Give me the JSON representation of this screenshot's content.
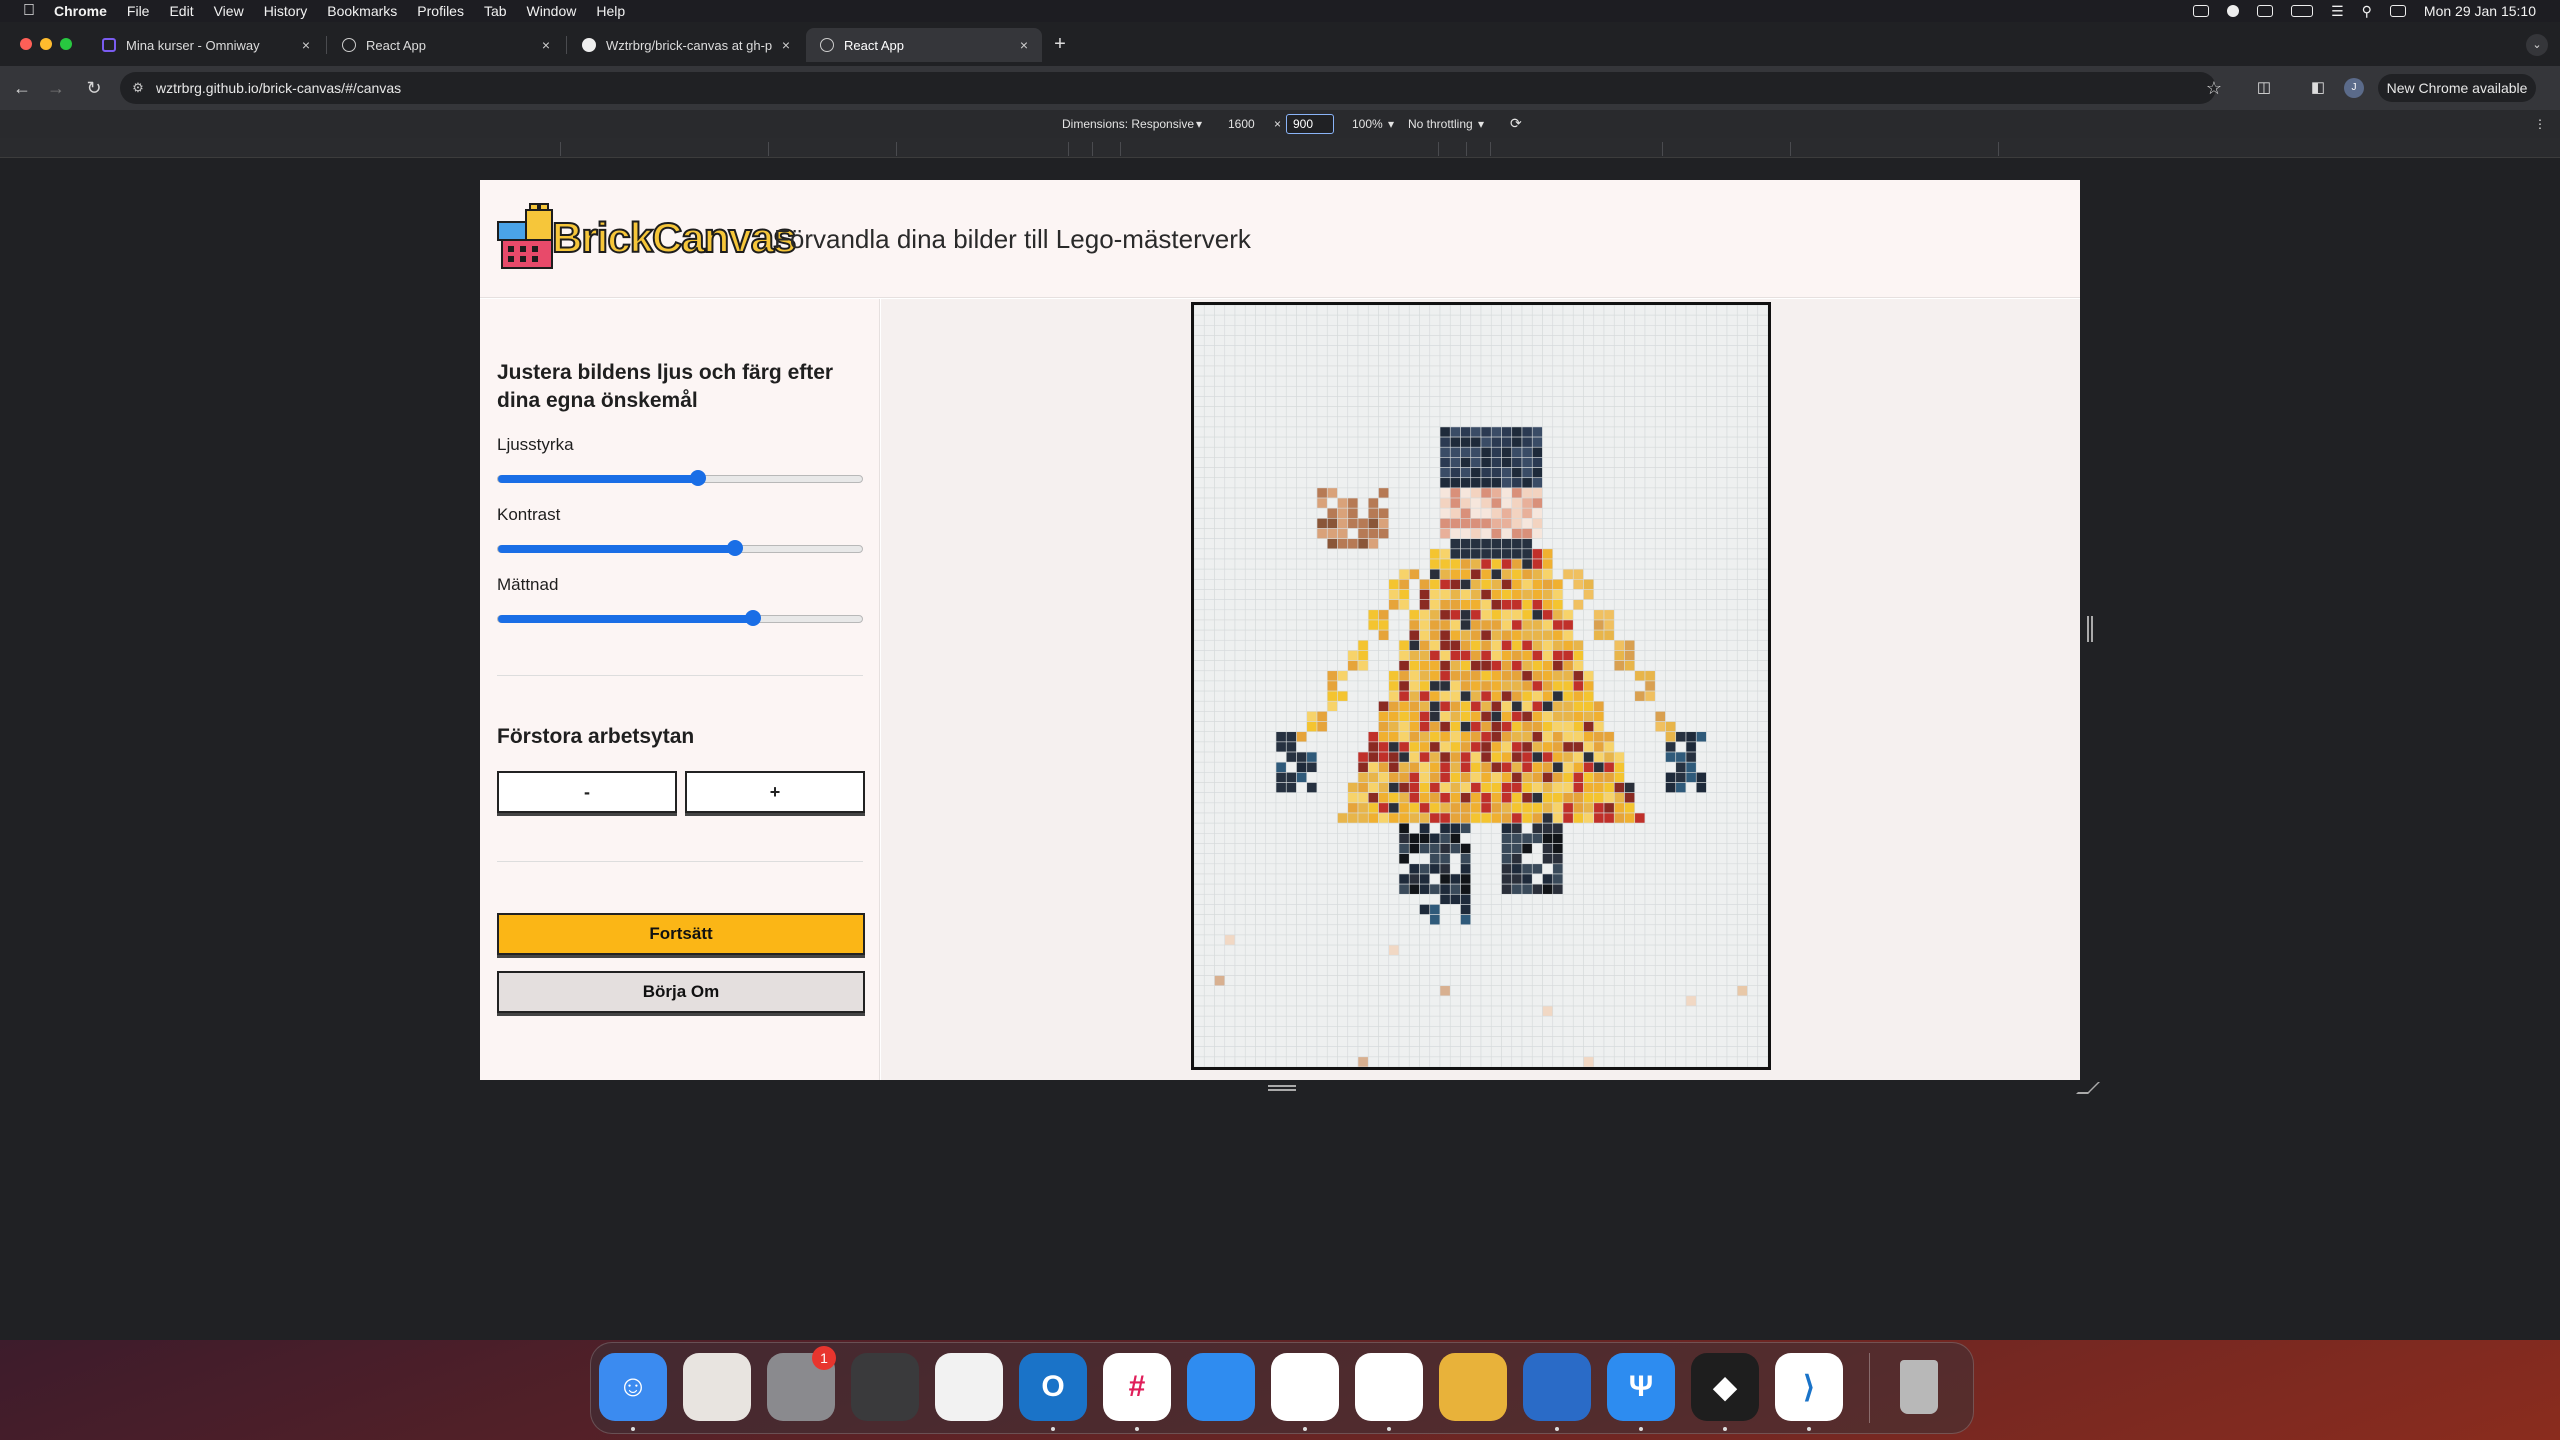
{
  "menubar": {
    "app": "Chrome",
    "items": [
      "File",
      "Edit",
      "View",
      "History",
      "Bookmarks",
      "Profiles",
      "Tab",
      "Window",
      "Help"
    ],
    "clock": "Mon 29 Jan  15:10"
  },
  "tabs": [
    {
      "title": "Mina kurser - Omniway",
      "icon": "omniway-icon"
    },
    {
      "title": "React App",
      "icon": "react-icon"
    },
    {
      "title": "Wztrbrg/brick-canvas at gh-p",
      "icon": "github-icon"
    },
    {
      "title": "React App",
      "icon": "react-icon"
    }
  ],
  "toolbar": {
    "url": "wztrbrg.github.io/brick-canvas/#/canvas",
    "update_label": "New Chrome available",
    "avatar_letter": "J"
  },
  "devtools": {
    "dimensions": "Dimensions: Responsive",
    "width": "1600",
    "height": "900",
    "zoom": "100%",
    "throttling": "No throttling"
  },
  "app": {
    "logo": "BrickCanvas",
    "tagline": "Förvandla dina bilder till Lego-mästerverk",
    "adjust_heading": "Justera bildens ljus och färg efter dina egna önskemål",
    "sliders": [
      {
        "label": "Ljusstyrka",
        "value": 0.55
      },
      {
        "label": "Kontrast",
        "value": 0.65
      },
      {
        "label": "Mättnad",
        "value": 0.7
      }
    ],
    "zoom_heading": "Förstora arbetsytan",
    "zoom_out": "-",
    "zoom_in": "+",
    "continue_label": "Fortsätt",
    "restart_label": "Börja Om"
  },
  "colors": {
    "accent": "#1a6ee6",
    "continue_bg": "#fbb616",
    "restart_bg": "#e4dfde",
    "logo_yellow": "#f6c63a"
  },
  "dock": [
    {
      "name": "finder",
      "color": "#3b8bf0"
    },
    {
      "name": "launchpad",
      "color": "#e8e4e0"
    },
    {
      "name": "system-settings",
      "color": "#8a8a8e"
    },
    {
      "name": "calculator",
      "color": "#3a3a3c"
    },
    {
      "name": "textedit",
      "color": "#f2f2f2"
    },
    {
      "name": "outlook",
      "color": "#1a73c8"
    },
    {
      "name": "slack",
      "color": "#ffffff"
    },
    {
      "name": "safari",
      "color": "#2f8cf0"
    },
    {
      "name": "chrome",
      "color": "#ffffff"
    },
    {
      "name": "mongodb",
      "color": "#ffffff"
    },
    {
      "name": "sequel-ace",
      "color": "#e8b23a"
    },
    {
      "name": "tableplus",
      "color": "#2a6bc7"
    },
    {
      "name": "fork",
      "color": "#2d8cf0"
    },
    {
      "name": "figma",
      "color": "#1e1e1e"
    },
    {
      "name": "vscode",
      "color": "#ffffff"
    },
    {
      "name": "trash",
      "color": "#9a9a9a"
    }
  ],
  "dock_badge": "1"
}
